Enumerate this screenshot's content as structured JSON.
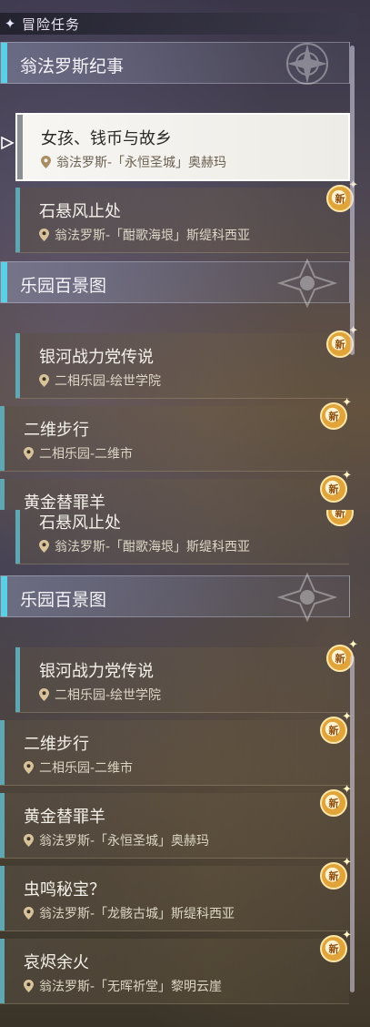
{
  "panel": {
    "title": "冒险任务"
  },
  "region_1": "翁法罗斯纪事",
  "region_2": "乐园百景图",
  "quests": {
    "girl": {
      "title": "女孩、钱币与故乡",
      "location": "翁法罗斯-「永恒圣城」奥赫玛"
    },
    "stone": {
      "title": "石悬风止处",
      "location": "翁法罗斯-「酣歌海垠」斯缇科西亚"
    },
    "galaxy": {
      "title": "银河战力党传说",
      "location": "二相乐园-绘世学院"
    },
    "twod": {
      "title": "二维步行",
      "location": "二相乐园-二维市"
    },
    "golden": {
      "title": "黄金替罪羊",
      "location": "翁法罗斯-「永恒圣城」奥赫玛"
    },
    "bug": {
      "title": "虫鸣秘宝？",
      "location": "翁法罗斯-「龙骸古城」斯缇科西亚"
    },
    "ember": {
      "title": "哀烬余火",
      "location": "翁法罗斯-「无晖祈堂」黎明云崖"
    }
  },
  "badge": {
    "text": "新"
  },
  "colors": {
    "accent_bar": "#5ad0e6",
    "quest_bar": "#5fa7b3",
    "badge": "#e0a43a"
  }
}
